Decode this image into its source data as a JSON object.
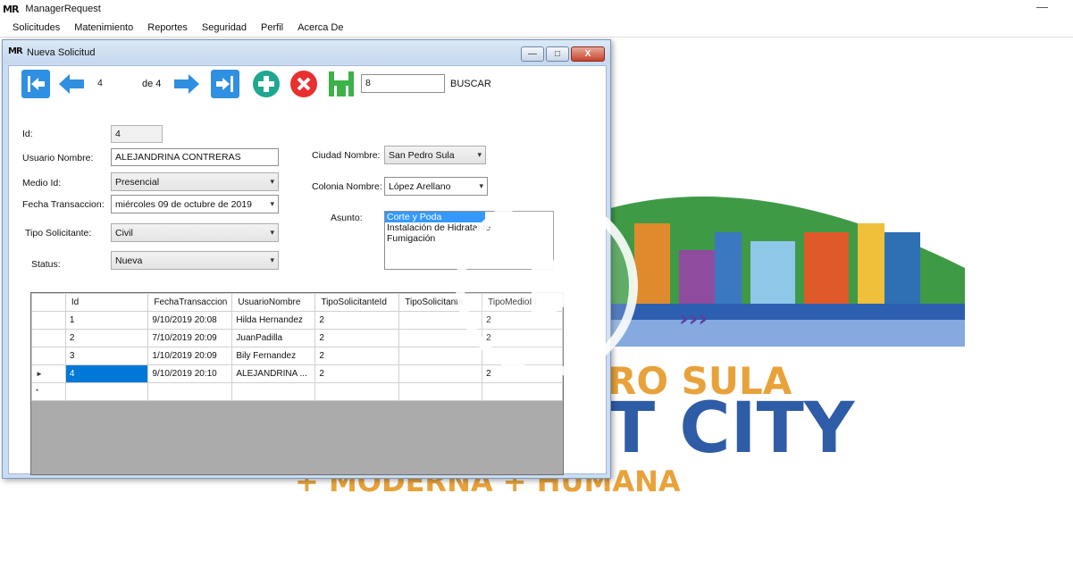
{
  "app": {
    "logo": "MR",
    "title": "ManagerRequest",
    "minimize": "—"
  },
  "menu": [
    "Solicitudes",
    "Matenimiento",
    "Reportes",
    "Seguridad",
    "Perfil",
    "Acerca De"
  ],
  "background": {
    "line1": "RO SULA",
    "line2": "T CITY",
    "line3": "+ MODERNA + HUMANA",
    "arrows": "›››"
  },
  "window": {
    "icon": "MR",
    "title": "Nueva Solicitud",
    "min": "—",
    "max": "□",
    "close": "X"
  },
  "toolbar": {
    "record_value": "4",
    "record_of": "de 4",
    "search_value": "8",
    "search_label": "BUSCAR",
    "icons": {
      "first": "first-record-icon",
      "prev": "previous-record-icon",
      "next": "next-record-icon",
      "last": "last-record-icon",
      "add": "add-icon",
      "delete": "delete-icon",
      "save": "save-icon"
    },
    "colors": {
      "nav": "#2f8fe0",
      "add": "#1fa88f",
      "delete": "#e8302e",
      "save": "#3db24a"
    }
  },
  "form": {
    "id_label": "Id:",
    "id_value": "4",
    "usuario_label": "Usuario Nombre:",
    "usuario_value": "ALEJANDRINA CONTRERAS",
    "medio_label": "Medio Id:",
    "medio_value": "Presencial",
    "fecha_label": "Fecha Transaccion:",
    "fecha_value": "miércoles 09 de   octubre   de 2019",
    "tipo_label": "Tipo Solicitante:",
    "tipo_value": "Civil",
    "status_label": "Status:",
    "status_value": "Nueva",
    "ciudad_label": "Ciudad Nombre:",
    "ciudad_value": "San Pedro Sula",
    "colonia_label": "Colonia Nombre:",
    "colonia_value": "López Arellano",
    "asunto_label": "Asunto:",
    "asunto_items": [
      "Corte y Poda",
      "Instalación de Hidratante",
      "Fumigación"
    ]
  },
  "grid": {
    "columns": [
      "Id",
      "FechaTransaccion",
      "UsuarioNombre",
      "TipoSolicitanteId",
      "TipoSolicitante",
      "TipoMedioId"
    ],
    "rows": [
      [
        "1",
        "9/10/2019 20:08",
        "Hilda Hernandez",
        "2",
        "",
        "2"
      ],
      [
        "2",
        "7/10/2019 20:09",
        "JuanPadilla",
        "2",
        "",
        "2"
      ],
      [
        "3",
        "1/10/2019 20:09",
        "Bily Fernandez",
        "2",
        "",
        ""
      ],
      [
        "4",
        "9/10/2019 20:10",
        "ALEJANDRINA ...",
        "2",
        "",
        "2"
      ]
    ],
    "current_marker": "►",
    "new_marker": "*"
  }
}
